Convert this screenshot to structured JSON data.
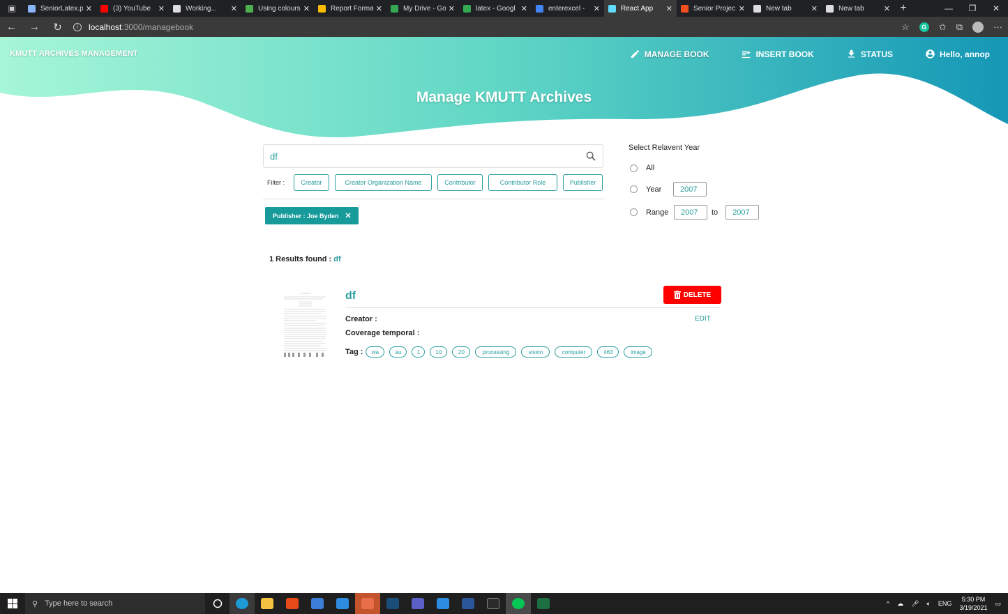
{
  "browser": {
    "tabs": [
      {
        "label": "SeniorLatex.p",
        "color": "#8ab4f8"
      },
      {
        "label": "(3) YouTube",
        "color": "#ff0000"
      },
      {
        "label": "Working...",
        "color": "#dddddd"
      },
      {
        "label": "Using colours",
        "color": "#4caf50"
      },
      {
        "label": "Report Forma",
        "color": "#fbbc04"
      },
      {
        "label": "My Drive - Go",
        "color": "#34a853"
      },
      {
        "label": "latex - Googl",
        "color": "#34a853"
      },
      {
        "label": "enterexcel - ",
        "color": "#4285f4"
      },
      {
        "label": "React App",
        "color": "#61dafb"
      },
      {
        "label": "Senior Projec",
        "color": "#f24e1e"
      },
      {
        "label": "New tab",
        "color": "#dddddd"
      },
      {
        "label": "New tab",
        "color": "#dddddd"
      }
    ],
    "active_tab_index": 8,
    "url_host": "localhost",
    "url_path": ":3000/managebook"
  },
  "app": {
    "brand": "KMUTT ARCHIVES MANAGEMENT",
    "nav": {
      "manage": "MANAGE BOOK",
      "insert": "INSERT BOOK",
      "status": "STATUS",
      "user": "Hello, annop"
    },
    "title": "Manage KMUTT Archives",
    "accent": "#2a9d9d"
  },
  "search": {
    "value": "df",
    "filter_label": "Filter :",
    "filters": [
      "Creator",
      "Creator Organization Name",
      "Contributor",
      "Contributor Role",
      "Publisher"
    ],
    "active_chip": "Publisher : Joe Byden"
  },
  "year": {
    "title": "Select Relavent Year",
    "all": "All",
    "year_label": "Year",
    "year_value": "2007",
    "range_label": "Range",
    "range_from": "2007",
    "to": "to",
    "range_to": "2007"
  },
  "results": {
    "count_text": "1 Results found : ",
    "query": "df",
    "items": [
      {
        "title": "df",
        "delete_label": "DELETE",
        "edit_label": "EDIT",
        "creator_label": "Creator :",
        "coverage_label": "Coverage temporal :",
        "tag_label": "Tag :",
        "tags": [
          "wa",
          "au",
          "1",
          "10",
          "20",
          "processing",
          "vision",
          "computer",
          "463",
          "image"
        ]
      }
    ]
  },
  "taskbar": {
    "search_placeholder": "Type here to search",
    "lang": "ENG",
    "time": "5:30 PM",
    "date": "3/19/2021"
  }
}
